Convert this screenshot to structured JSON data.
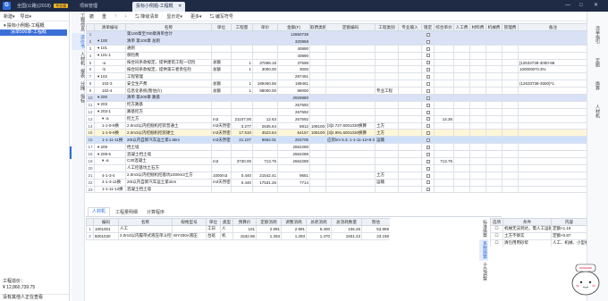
{
  "app": {
    "logo": "G",
    "tabs": [
      {
        "label": "全国(公路)(2018)",
        "badge": "专业版"
      },
      {
        "label": "项目管理"
      },
      {
        "label": "投标小例题-工程概",
        "active": true
      }
    ],
    "window_controls": [
      "—",
      "□",
      "✕"
    ]
  },
  "left_panel": {
    "toolbar": [
      "新建▾",
      "导出▾"
    ],
    "tree_root": "▾ 投标小例题-工程概",
    "tree_child": "清单500章-工程概",
    "footer": {
      "label": "工程造价：",
      "value": "¥ 12,860,739.75",
      "status": "没有其他人正在查看"
    }
  },
  "vertical_nav": [
    "工程信息",
    "造价书",
    "人材机",
    "报表",
    "分摊",
    "指标"
  ],
  "toolbar": [
    "撤",
    "重",
    "↑",
    "↓",
    "⇆ 降级清单",
    "显示定▾",
    "更多▾",
    "⇆ 编写符号"
  ],
  "table": {
    "headers": [
      "",
      "清单编号",
      "名称",
      "单位",
      "工程量",
      "单价",
      "金额(F)",
      "取费类别",
      "定额编码",
      "工程类别",
      "专业输入",
      "锁定",
      "综合单价",
      "人工费",
      "材料费",
      "机械费",
      "管理费",
      "备注"
    ],
    "rows": [
      {
        "style": "section",
        "idx": "1",
        "code": "",
        "name": "第100章至700章清单合计",
        "unit": "",
        "qty": "",
        "price": "",
        "amount": "12860739",
        "feeclass": "",
        "quota": "",
        "cat": "",
        "spec": "",
        "rate": "",
        "lab": "",
        "mat": "",
        "mach": "",
        "mgmt": "",
        "note": ""
      },
      {
        "style": "section",
        "idx": "2",
        "code": "▾ 100",
        "name": "清单 第100章 总则",
        "unit": "",
        "qty": "",
        "price": "",
        "amount": "320859",
        "feeclass": "",
        "quota": "",
        "cat": "",
        "spec": "",
        "rate": "",
        "lab": "",
        "mat": "",
        "mach": "",
        "mgmt": "",
        "note": ""
      },
      {
        "style": "plain",
        "idx": "3",
        "code": "▾ 101",
        "name": "通则",
        "unit": "",
        "qty": "",
        "price": "",
        "amount": "40890",
        "feeclass": "",
        "quota": "",
        "cat": "",
        "spec": "",
        "rate": "",
        "lab": "",
        "mat": "",
        "mach": "",
        "mgmt": "",
        "note": ""
      },
      {
        "style": "plain",
        "idx": "4",
        "code": "▾ 101-1",
        "name": "保险费",
        "unit": "",
        "qty": "",
        "price": "",
        "amount": "40890",
        "feeclass": "",
        "quota": "",
        "cat": "",
        "spec": "",
        "rate": "",
        "lab": "",
        "mat": "",
        "mach": "",
        "mgmt": "",
        "note": ""
      },
      {
        "style": "plain",
        "idx": "5",
        "code": "-a",
        "name": "按合同条款规定，提供建筑工程一切险",
        "unit": "总额",
        "qty": "1",
        "price": "37598.19",
        "amount": "37598",
        "feeclass": "",
        "quota": "",
        "cat": "",
        "spec": "",
        "rate": "",
        "lab": "",
        "mat": "",
        "mach": "",
        "mgmt": "",
        "note": "[12633738-3000-98"
      },
      {
        "style": "plain",
        "idx": "6",
        "code": "-b",
        "name": "按合同条款规定，提供第三者责任险",
        "unit": "总额",
        "qty": "1",
        "price": "3000.00",
        "amount": "3000",
        "feeclass": "",
        "quota": "",
        "cat": "",
        "spec": "",
        "rate": "",
        "lab": "",
        "mat": "",
        "mach": "",
        "mgmt": "",
        "note": "1000000*0.3%"
      },
      {
        "style": "plain",
        "idx": "7",
        "code": "▾ 102",
        "name": "工程管理",
        "unit": "",
        "qty": "",
        "price": "",
        "amount": "287461",
        "feeclass": "",
        "quota": "",
        "cat": "",
        "spec": "",
        "rate": "",
        "lab": "",
        "mat": "",
        "mach": "",
        "mgmt": "",
        "note": ""
      },
      {
        "style": "plain",
        "idx": "8",
        "code": "102-3",
        "name": "安全生产费",
        "unit": "总额",
        "qty": "1",
        "price": "189460.56",
        "amount": "189461",
        "feeclass": "",
        "quota": "",
        "cat": "",
        "spec": "",
        "rate": "",
        "lab": "",
        "mat": "",
        "mach": "",
        "mgmt": "",
        "note": "(12633738-3000)*1."
      },
      {
        "style": "plain",
        "idx": "9",
        "code": "102-4",
        "name": "信息化系统(暂估价)",
        "unit": "总额",
        "qty": "1",
        "price": "98000.00",
        "amount": "98000",
        "feeclass": "",
        "quota": "",
        "cat": "专业工程",
        "spec": "",
        "rate": "",
        "lab": "",
        "mat": "",
        "mach": "",
        "mgmt": "",
        "note": ""
      },
      {
        "style": "section",
        "idx": "10",
        "code": "▾ 200",
        "name": "清单 第200章 路基",
        "unit": "",
        "qty": "",
        "price": "",
        "amount": "2929880",
        "feeclass": "",
        "quota": "",
        "cat": "",
        "spec": "",
        "rate": "",
        "lab": "",
        "mat": "",
        "mach": "",
        "mgmt": "",
        "note": ""
      },
      {
        "style": "plain",
        "idx": "11",
        "code": "▾ 203",
        "name": "挖方路基",
        "unit": "",
        "qty": "",
        "price": "",
        "amount": "267592",
        "feeclass": "",
        "quota": "",
        "cat": "",
        "spec": "",
        "rate": "",
        "lab": "",
        "mat": "",
        "mach": "",
        "mgmt": "",
        "note": ""
      },
      {
        "style": "plain",
        "idx": "12",
        "code": "▾ 203-1",
        "name": "路基挖方",
        "unit": "",
        "qty": "",
        "price": "",
        "amount": "267592",
        "feeclass": "",
        "quota": "",
        "cat": "",
        "spec": "",
        "rate": "",
        "lab": "",
        "mat": "",
        "mach": "",
        "mgmt": "",
        "note": ""
      },
      {
        "style": "plain",
        "idx": "13",
        "code": "▾ -a",
        "name": "挖土方",
        "unit": "m3",
        "qty": "21107.00",
        "price": "12.63",
        "amount": "267592",
        "feeclass": "",
        "quota": "",
        "cat": "",
        "spec": "",
        "rate": "14.36",
        "lab": "",
        "mat": "",
        "mach": "",
        "mgmt": "",
        "note": ""
      },
      {
        "style": "plain",
        "idx": "14",
        "code": "1-1-9-8换",
        "name": "2.0m3以内挖掘机挖装普通土",
        "unit": "m3天然密",
        "qty": "3.277",
        "price": "2635.64",
        "amount": "8812",
        "feeclass": "1081001",
        "quota": "[3]2.727.6001030换算",
        "cat": "土方",
        "spec": "",
        "rate": "",
        "lab": "",
        "mat": "",
        "mach": "",
        "mgmt": "",
        "note": ""
      },
      {
        "style": "yellow",
        "idx": "15",
        "code": "1-1-9-9换",
        "name": "2.0m3以内挖掘机挖装硬土",
        "unit": "m3天然密",
        "qty": "17.510",
        "price": "3523.64",
        "amount": "54157",
        "feeclass": "1081001",
        "quota": "[3]2.991.6001030换算",
        "cat": "土方",
        "spec": "",
        "rate": "",
        "lab": "",
        "mat": "",
        "mach": "",
        "mgmt": "",
        "note": ""
      },
      {
        "style": "blue",
        "idx": "16",
        "code": "1-1-11-11换",
        "name": "20t以内自卸汽车运土第1.5km",
        "unit": "m3天然密",
        "qty": "21.107",
        "price": "9662.01",
        "amount": "204705",
        "feeclass": "",
        "quota": "应装km 5.3; 1-1-11-12×9.0",
        "cat": "运输",
        "spec": "",
        "rate": "",
        "lab": "",
        "mat": "",
        "mach": "",
        "mgmt": "",
        "note": ""
      },
      {
        "style": "plain",
        "idx": "17",
        "code": "▾ 209",
        "name": "挡土墙",
        "unit": "",
        "qty": "",
        "price": "",
        "amount": "2662288",
        "feeclass": "",
        "quota": "",
        "cat": "",
        "spec": "",
        "rate": "",
        "lab": "",
        "mat": "",
        "mach": "",
        "mgmt": "",
        "note": ""
      },
      {
        "style": "plain",
        "idx": "18",
        "code": "▾ 209-5",
        "name": "混凝土挡土墙",
        "unit": "",
        "qty": "",
        "price": "",
        "amount": "2662288",
        "feeclass": "",
        "quota": "",
        "cat": "",
        "spec": "",
        "rate": "",
        "lab": "",
        "mat": "",
        "mach": "",
        "mgmt": "",
        "note": ""
      },
      {
        "style": "plain",
        "idx": "19",
        "code": "▾ -a",
        "name": "C30混凝土",
        "unit": "m3",
        "qty": "3730.00",
        "price": "713.75",
        "amount": "2662288",
        "feeclass": "",
        "quota": "",
        "cat": "",
        "spec": "",
        "rate": "713.75",
        "lab": "",
        "mat": "",
        "mach": "",
        "mgmt": "",
        "note": ""
      },
      {
        "style": "plain",
        "idx": "20",
        "code": "",
        "name": "人工挖基坑土石方",
        "unit": "",
        "qty": "",
        "price": "",
        "amount": "",
        "feeclass": "",
        "quota": "",
        "cat": "",
        "spec": "",
        "rate": "",
        "lab": "",
        "mat": "",
        "mach": "",
        "mgmt": "",
        "note": ""
      },
      {
        "style": "plain",
        "idx": "21",
        "code": "4-1-3-4",
        "name": "2.0m3以内挖掘机挖基坑1000m3土方",
        "unit": "1000m3",
        "qty": "0.440",
        "price": "21542.41",
        "amount": "9651",
        "feeclass": "",
        "quota": "",
        "cat": "土方",
        "spec": "",
        "rate": "",
        "lab": "",
        "mat": "",
        "mach": "",
        "mgmt": "",
        "note": ""
      },
      {
        "style": "plain",
        "idx": "22",
        "code": "4-1-3-11换",
        "name": "20t以内自卸汽车运土第1km",
        "unit": "m3天然密",
        "qty": "0.440",
        "price": "17531.26",
        "amount": "7714",
        "feeclass": "",
        "quota": "",
        "cat": "运输",
        "spec": "",
        "rate": "",
        "lab": "",
        "mat": "",
        "mach": "",
        "mgmt": "",
        "note": ""
      },
      {
        "style": "plain",
        "idx": "23",
        "code": "1-1-11-12换",
        "name": "混凝土挡土墙",
        "unit": "",
        "qty": "",
        "price": "",
        "amount": "",
        "feeclass": "",
        "quota": "",
        "cat": "",
        "spec": "",
        "rate": "",
        "lab": "",
        "mat": "",
        "mach": "",
        "mgmt": "",
        "note": ""
      }
    ]
  },
  "bottom_tabs": [
    "人材机",
    "工程量明细",
    "计算程序"
  ],
  "bottom_table": {
    "headers": [
      "",
      "编码",
      "名称",
      "规格型号",
      "单位",
      "类型",
      "预算价",
      "定额消耗",
      "调整消耗",
      "总耗消耗",
      "总消耗数量",
      "暂估"
    ],
    "rows": [
      [
        "1",
        "1001001",
        "人工",
        "",
        "工日",
        "人",
        "101",
        "2.991",
        "2.991",
        "5.400",
        "106.25",
        "53.959"
      ],
      [
        "2",
        "8001030",
        "2.0m3以内履带式液压单斗挖掘机",
        "WY200A液压",
        "台班",
        "机",
        "1532.96",
        "1.293",
        "1.293",
        "1.470",
        "1501.23",
        "23.158"
      ]
    ]
  },
  "mid_table": {
    "headers": [
      "",
      "小计"
    ],
    "rows": [
      [
        "",
        ""
      ],
      [
        "",
        ""
      ]
    ]
  },
  "cond_nav": [
    "标准换算",
    "系数换算",
    "子目调整"
  ],
  "cond_table": {
    "headers": [
      "选项",
      "条件",
      "内容"
    ],
    "rows": [
      [
        "☐",
        "机械无法到达，需人工运输",
        "定额×1.15"
      ],
      [
        "☐",
        "土方不够实",
        "定额×0.87"
      ],
      [
        "☐",
        "清包用用砂浆",
        "人工、机械、小型机具"
      ]
    ]
  },
  "right_sidebar": [
    "清单指引",
    "定额",
    "换算",
    "人材机"
  ]
}
